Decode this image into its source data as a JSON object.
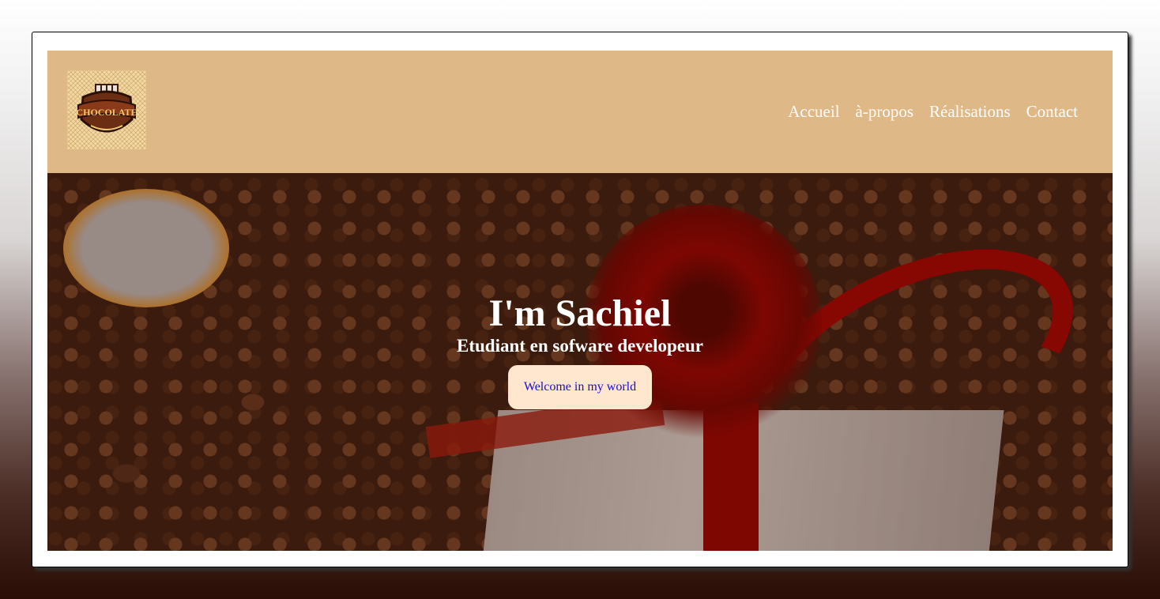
{
  "header": {
    "logo_text": "CHOCOLATE",
    "nav": [
      {
        "label": "Accueil"
      },
      {
        "label": "à-propos"
      },
      {
        "label": "Réalisations"
      },
      {
        "label": "Contact"
      }
    ]
  },
  "hero": {
    "title": "I'm Sachiel",
    "subtitle": "Etudiant en sofware developeur",
    "button_label": "Welcome in my world"
  },
  "colors": {
    "header_bg": "#dfb887",
    "button_bg": "#ffe6cf",
    "button_text": "#1a0dd8",
    "nav_text": "#ffffff"
  }
}
